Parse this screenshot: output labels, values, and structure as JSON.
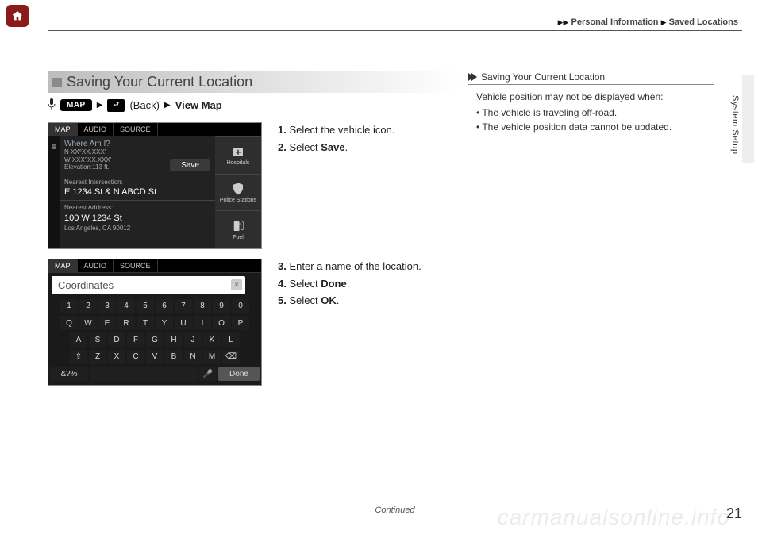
{
  "header": {
    "path1": "Personal Information",
    "path2": "Saved Locations"
  },
  "side_section": "System Setup",
  "section": {
    "title": "Saving Your Current Location",
    "map_label": "MAP",
    "back_label": "(Back)",
    "view_map": "View Map"
  },
  "screenshot1": {
    "tabs": [
      "MAP",
      "AUDIO",
      "SOURCE"
    ],
    "whereami": "Where Am I?",
    "coords_n": "N XX°XX.XXX'",
    "coords_w": "W XXX°XX.XXX'",
    "elev": "Elevation:113 ft.",
    "save": "Save",
    "ni_label": "Nearest Intersection:",
    "ni_value": "E 1234 St  &  N ABCD St",
    "na_label": "Nearest Address:",
    "na_value": "100 W 1234 St",
    "na_city": "Los Angeles, CA 90012",
    "cats": [
      "Hospitals",
      "Police Stations",
      "Fuel"
    ]
  },
  "screenshot2": {
    "tabs": [
      "MAP",
      "AUDIO",
      "SOURCE"
    ],
    "input": "Coordinates",
    "row1": [
      "1",
      "2",
      "3",
      "4",
      "5",
      "6",
      "7",
      "8",
      "9",
      "0"
    ],
    "row2": [
      "Q",
      "W",
      "E",
      "R",
      "T",
      "Y",
      "U",
      "I",
      "O",
      "P"
    ],
    "row3": [
      "A",
      "S",
      "D",
      "F",
      "G",
      "H",
      "J",
      "K",
      "L"
    ],
    "row4": [
      "Z",
      "X",
      "C",
      "V",
      "B",
      "N",
      "M"
    ],
    "sym": "&?%",
    "done": "Done"
  },
  "steps1": [
    {
      "n": "1.",
      "t": "Select the vehicle icon."
    },
    {
      "n": "2.",
      "t_pre": "Select ",
      "t_b": "Save",
      "t_post": "."
    }
  ],
  "steps2": [
    {
      "n": "3.",
      "t": "Enter a name of the location."
    },
    {
      "n": "4.",
      "t_pre": "Select ",
      "t_b": "Done",
      "t_post": "."
    },
    {
      "n": "5.",
      "t_pre": "Select ",
      "t_b": "OK",
      "t_post": "."
    }
  ],
  "sidenote": {
    "title": "Saving Your Current Location",
    "intro": "Vehicle position may not be displayed when:",
    "bullets": [
      "The vehicle is traveling off-road.",
      "The vehicle position data cannot be updated."
    ]
  },
  "footer": {
    "continued": "Continued",
    "page": "21"
  },
  "watermark": "carmanualsonline.info"
}
